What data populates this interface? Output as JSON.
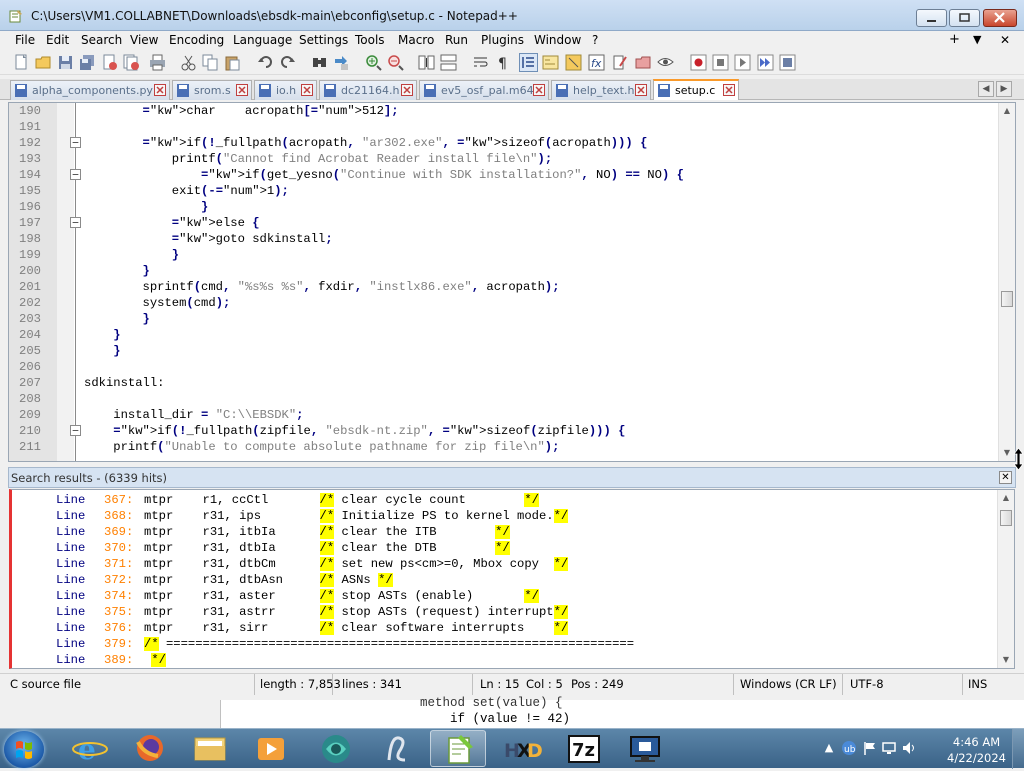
{
  "window": {
    "title": "C:\\Users\\VM1.COLLABNET\\Downloads\\ebsdk-main\\ebconfig\\setup.c - Notepad++"
  },
  "menu": [
    "File",
    "Edit",
    "Search",
    "View",
    "Encoding",
    "Language",
    "Settings",
    "Tools",
    "Macro",
    "Run",
    "Plugins",
    "Window",
    "?"
  ],
  "menu_right": {
    "plus": "+",
    "down": "▼",
    "close": "✕"
  },
  "tabs": [
    {
      "label": "alpha_components.py",
      "active": false
    },
    {
      "label": "srom.s",
      "active": false
    },
    {
      "label": "io.h",
      "active": false
    },
    {
      "label": "dc21164.h",
      "active": false
    },
    {
      "label": "ev5_osf_pal.m64",
      "active": false
    },
    {
      "label": "help_text.h",
      "active": false
    },
    {
      "label": "setup.c",
      "active": true
    }
  ],
  "editor": {
    "lines": [
      {
        "n": "190",
        "code": "        char    acropath[512];"
      },
      {
        "n": "191",
        "code": ""
      },
      {
        "n": "192",
        "code": "        if(!_fullpath(acropath, \"ar302.exe\", sizeof(acropath))) {"
      },
      {
        "n": "193",
        "code": "            printf(\"Cannot find Acrobat Reader install file\\n\");"
      },
      {
        "n": "194",
        "code": "                if(get_yesno(\"Continue with SDK installation?\", NO) == NO) {"
      },
      {
        "n": "195",
        "code": "            exit(-1);"
      },
      {
        "n": "196",
        "code": "                }"
      },
      {
        "n": "197",
        "code": "            else {"
      },
      {
        "n": "198",
        "code": "            goto sdkinstall;"
      },
      {
        "n": "199",
        "code": "            }"
      },
      {
        "n": "200",
        "code": "        }"
      },
      {
        "n": "201",
        "code": "        sprintf(cmd, \"%s%s %s\", fxdir, \"instlx86.exe\", acropath);"
      },
      {
        "n": "202",
        "code": "        system(cmd);"
      },
      {
        "n": "203",
        "code": "        }"
      },
      {
        "n": "204",
        "code": "    }"
      },
      {
        "n": "205",
        "code": "    }"
      },
      {
        "n": "206",
        "code": ""
      },
      {
        "n": "207",
        "code": "sdkinstall:"
      },
      {
        "n": "208",
        "code": ""
      },
      {
        "n": "209",
        "code": "    install_dir = \"C:\\\\EBSDK\";"
      },
      {
        "n": "210",
        "code": "    if(!_fullpath(zipfile, \"ebsdk-nt.zip\", sizeof(zipfile))) {"
      },
      {
        "n": "211",
        "code": "    printf(\"Unable to compute absolute pathname for zip file\\n\");"
      }
    ]
  },
  "search": {
    "title": "Search results - (6339 hits)",
    "results": [
      {
        "prefix": "Line",
        "num": "367:",
        "text": "mtpr    r1, ccCtl       /* clear cycle count        */"
      },
      {
        "prefix": "Line",
        "num": "368:",
        "text": "mtpr    r31, ips        /* Initialize PS to kernel mode.*/"
      },
      {
        "prefix": "Line",
        "num": "369:",
        "text": "mtpr    r31, itbIa      /* clear the ITB        */"
      },
      {
        "prefix": "Line",
        "num": "370:",
        "text": "mtpr    r31, dtbIa      /* clear the DTB        */"
      },
      {
        "prefix": "Line",
        "num": "371:",
        "text": "mtpr    r31, dtbCm      /* set new ps<cm>=0, Mbox copy  */"
      },
      {
        "prefix": "Line",
        "num": "372:",
        "text": "mtpr    r31, dtbAsn     /* ASNs */"
      },
      {
        "prefix": "Line",
        "num": "374:",
        "text": "mtpr    r31, aster      /* stop ASTs (enable)       */"
      },
      {
        "prefix": "Line",
        "num": "375:",
        "text": "mtpr    r31, astrr      /* stop ASTs (request) interrupt*/"
      },
      {
        "prefix": "Line",
        "num": "376:",
        "text": "mtpr    r31, sirr       /* clear software interrupts    */"
      },
      {
        "prefix": "Line",
        "num": "379:",
        "text": "/* ================================================================"
      },
      {
        "prefix": "Line",
        "num": "389:",
        "text": " */"
      }
    ]
  },
  "status": {
    "type": "C source file",
    "length": "length : 7,853",
    "lines": "lines : 341",
    "ln": "Ln : 15",
    "col": "Col : 5",
    "pos": "Pos : 249",
    "eol": "Windows (CR LF)",
    "encoding": "UTF-8",
    "mode": "INS"
  },
  "background_window": {
    "line1": "method set(value) {",
    "line2": "    if (value != 42)"
  },
  "taskbar": {
    "time": "4:46 AM",
    "date": "4/22/2024",
    "apps": [
      "internet-explorer",
      "firefox",
      "file-explorer",
      "media-player",
      "bing-browser",
      "vlc-style",
      "notepad-plus-plus",
      "hxd-hex-editor",
      "7zip",
      "remote-desktop"
    ]
  },
  "colors": {
    "keyword": "#0000ff",
    "string": "#808080",
    "number": "#ff8000",
    "operator": "#000080",
    "active_tab_accent": "#fa9a2a",
    "search_accent": "#e53333"
  }
}
